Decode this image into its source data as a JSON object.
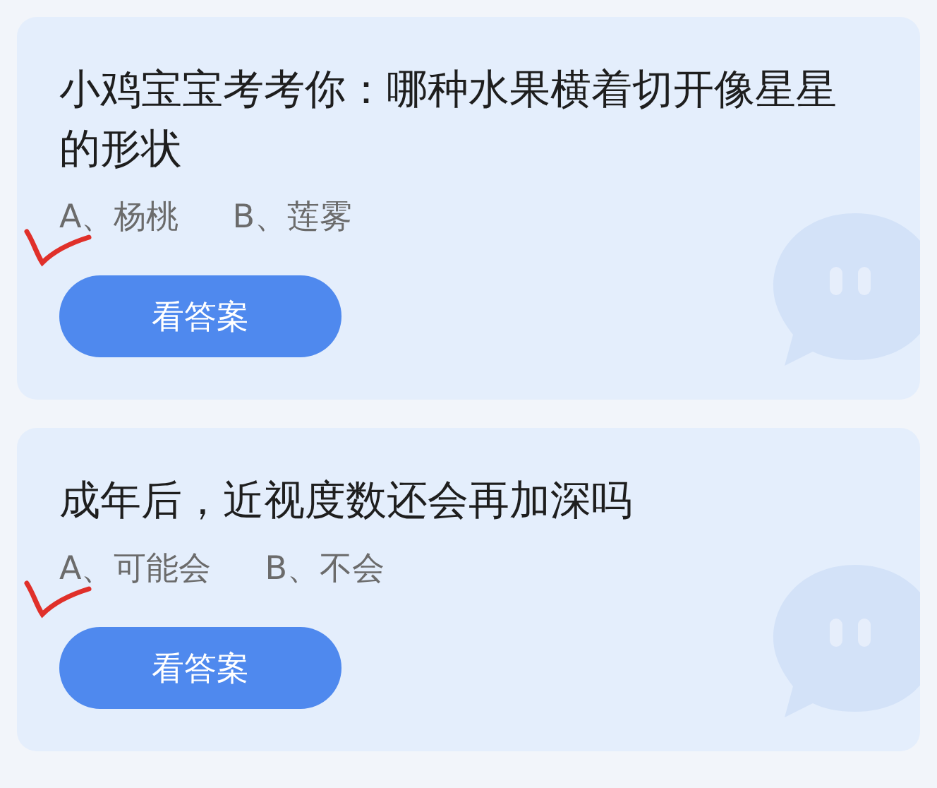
{
  "questions": [
    {
      "title": "小鸡宝宝考考你：哪种水果横着切开像星星的形状",
      "options": [
        {
          "text": "A、杨桃",
          "marked": true
        },
        {
          "text": "B、莲雾",
          "marked": false
        }
      ],
      "button": "看答案"
    },
    {
      "title": "成年后，近视度数还会再加深吗",
      "options": [
        {
          "text": "A、可能会",
          "marked": true
        },
        {
          "text": "B、不会",
          "marked": false
        }
      ],
      "button": "看答案"
    }
  ]
}
